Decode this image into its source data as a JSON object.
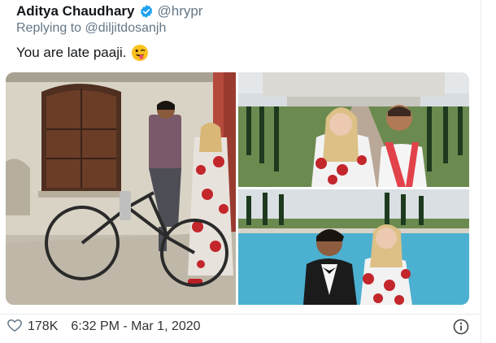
{
  "tweet": {
    "name": "Aditya Chaudhary",
    "handle": "@hrypr",
    "reply_prefix": "Replying to",
    "reply_to": "@diljitdosanjh",
    "text": "You are late paaji.",
    "emoji_icon": "winking-face-with-tongue-emoji",
    "verified_icon": "verified-badge-icon",
    "accent_color": "#1da1f2"
  },
  "media": {
    "images": [
      "photo-man-on-bicycle-with-woman-in-red-floral-dress",
      "photo-woman-and-man-with-red-scarf-at-taj-mahal",
      "photo-young-man-in-suit-and-woman-at-taj-mahal-pool"
    ]
  },
  "footer": {
    "like_icon": "heart-icon",
    "like_count": "178K",
    "timestamp": "6:32 PM - Mar 1, 2020",
    "info_icon": "info-icon"
  }
}
